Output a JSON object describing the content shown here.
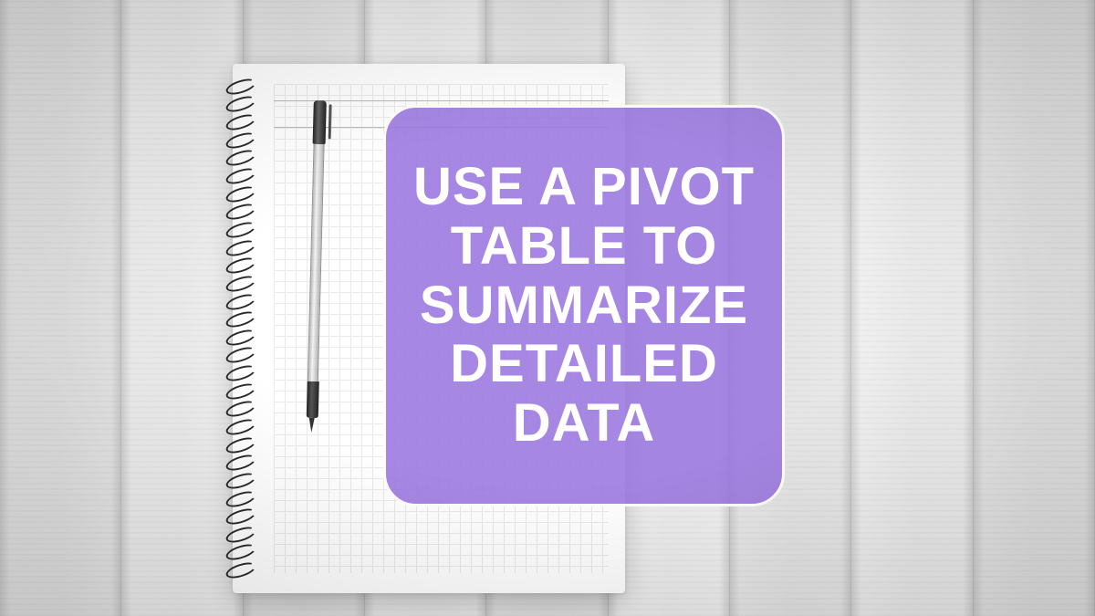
{
  "callout": {
    "text": "USE A PIVOT TABLE TO SUMMARIZE DETAILED DATA"
  },
  "colors": {
    "callout_bg": "#9a76e0",
    "callout_border": "#ffffff",
    "callout_text": "#ffffff"
  }
}
